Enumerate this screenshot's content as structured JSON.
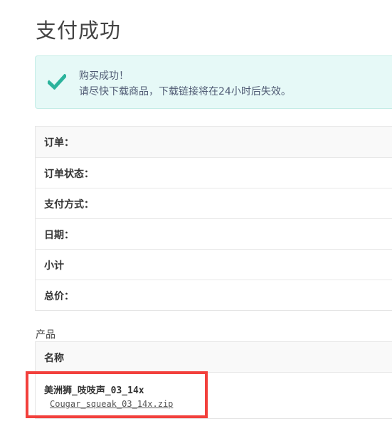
{
  "page": {
    "title": "支付成功"
  },
  "notice": {
    "icon": "check-icon",
    "accent_color": "#2bb39c",
    "line1": "购买成功！",
    "line2": "请尽快下载商品，下载链接将在24小时后失效。"
  },
  "order_details": {
    "rows": [
      {
        "label": "订单："
      },
      {
        "label": "订单状态："
      },
      {
        "label": "支付方式："
      },
      {
        "label": "日期："
      },
      {
        "label": "小计"
      },
      {
        "label": "总价："
      }
    ]
  },
  "products": {
    "section_label": "产品",
    "column_header": "名称",
    "items": [
      {
        "name": "美洲狮_吱吱声_03_14x",
        "download_link": "Cougar_squeak_03_14x.zip"
      }
    ]
  },
  "annotation": {
    "highlight_color": "#f2403c"
  }
}
